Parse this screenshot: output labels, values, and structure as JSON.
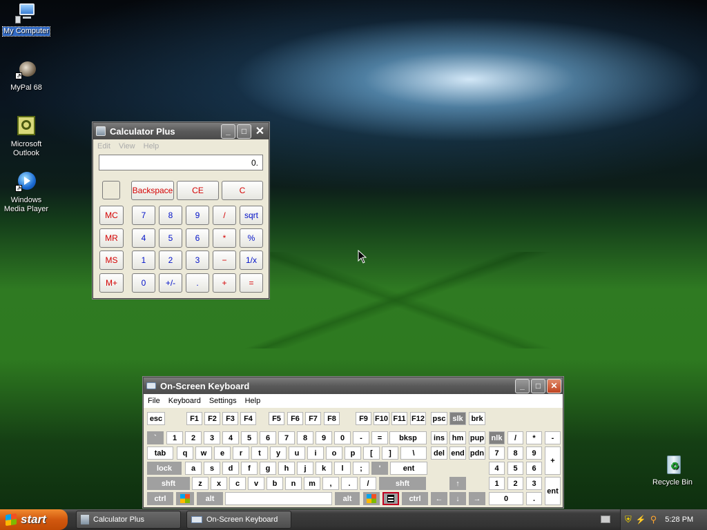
{
  "desktop": {
    "icons": [
      {
        "label": "My Computer"
      },
      {
        "label": "MyPal 68"
      },
      {
        "label": "Microsoft Outlook"
      },
      {
        "label": "Windows Media Player"
      },
      {
        "label": "Recycle Bin"
      }
    ]
  },
  "calc": {
    "title": "Calculator Plus",
    "menu": [
      "Edit",
      "View",
      "Help"
    ],
    "display": "0.",
    "top": [
      "Backspace",
      "CE",
      "C"
    ],
    "rows": [
      [
        "MC",
        "7",
        "8",
        "9",
        "/",
        "sqrt"
      ],
      [
        "MR",
        "4",
        "5",
        "6",
        "*",
        "%"
      ],
      [
        "MS",
        "1",
        "2",
        "3",
        "−",
        "1/x"
      ],
      [
        "M+",
        "0",
        "+/-",
        ".",
        "+",
        "="
      ]
    ]
  },
  "osk": {
    "title": "On-Screen Keyboard",
    "menu": [
      "File",
      "Keyboard",
      "Settings",
      "Help"
    ],
    "fn": [
      "esc",
      "F1",
      "F2",
      "F3",
      "F4",
      "F5",
      "F6",
      "F7",
      "F8",
      "F9",
      "F10",
      "F11",
      "F12",
      "psc",
      "slk",
      "brk"
    ],
    "num": [
      "`",
      "1",
      "2",
      "3",
      "4",
      "5",
      "6",
      "7",
      "8",
      "9",
      "0",
      "-",
      "=",
      "bksp",
      "ins",
      "hm",
      "pup",
      "nlk",
      "/",
      "*",
      "-"
    ],
    "qwerty": [
      "tab",
      "q",
      "w",
      "e",
      "r",
      "t",
      "y",
      "u",
      "i",
      "o",
      "p",
      "[",
      "]",
      "\\",
      "del",
      "end",
      "pdn",
      "7",
      "8",
      "9",
      "+"
    ],
    "home": [
      "lock",
      "a",
      "s",
      "d",
      "f",
      "g",
      "h",
      "j",
      "k",
      "l",
      ";",
      "'",
      "ent",
      "4",
      "5",
      "6"
    ],
    "shift": [
      "shft",
      "z",
      "x",
      "c",
      "v",
      "b",
      "n",
      "m",
      ",",
      ".",
      "/",
      "shft",
      "1",
      "2",
      "3",
      "ent"
    ],
    "bottom": [
      "ctrl",
      "alt",
      "alt",
      "ctrl",
      "0",
      "."
    ],
    "arrows": [
      "↑",
      "←",
      "↓",
      "→"
    ]
  },
  "taskbar": {
    "start": "start",
    "items": [
      "Calculator Plus",
      "On-Screen Keyboard"
    ],
    "clock": "5:28 PM"
  },
  "colors": {
    "start": "#d2580f",
    "titlebar": "#5a5a5a",
    "accent_red": "#d40000",
    "accent_blue": "#0010c8"
  }
}
